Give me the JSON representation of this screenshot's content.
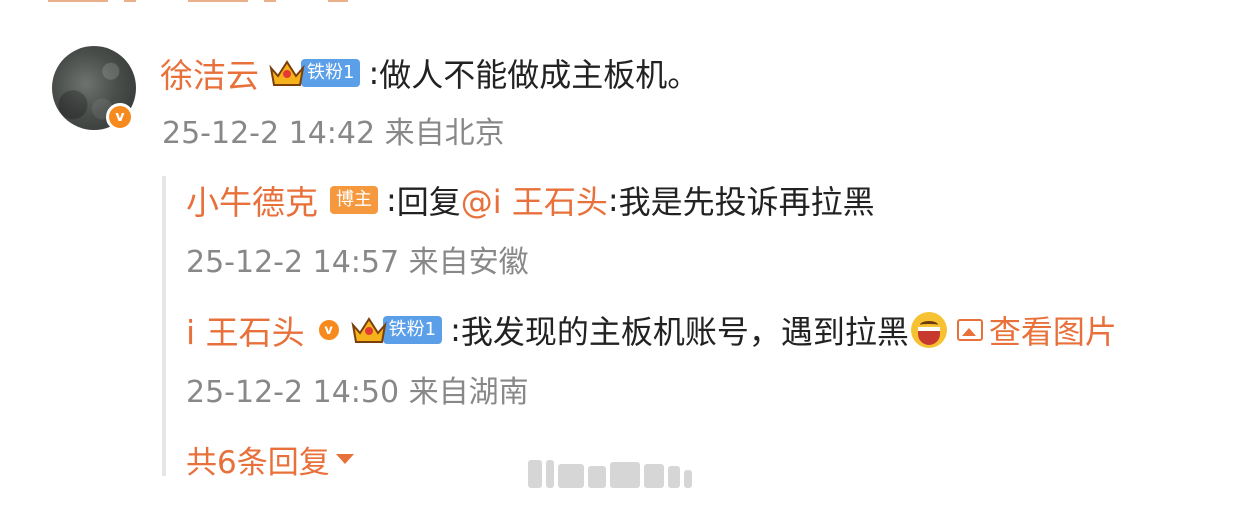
{
  "comment": {
    "author": "徐洁云",
    "fan_badge": "铁粉1",
    "text": "做人不能做成主板机。",
    "time": "25-12-2 14:42",
    "location": "来自北京",
    "verified_icon": "v-badge-icon"
  },
  "replies": [
    {
      "author": "小牛德克",
      "role_badge": "博主",
      "reply_prefix": "回复",
      "mention": "@i 王石头",
      "text": "我是先投诉再拉黑",
      "time": "25-12-2 14:57",
      "location": "来自安徽"
    },
    {
      "author": "i 王石头",
      "fan_badge": "铁粉1",
      "text": "我发现的主板机账号，遇到拉黑",
      "emoji": "grin-emoji",
      "view_image": "查看图片",
      "time": "25-12-2 14:50",
      "location": "来自湖南"
    }
  ],
  "more_replies": "共6条回复",
  "colors": {
    "accent": "#e8703a",
    "fan_badge": "#5b9fe8",
    "blogger_badge": "#f6983e",
    "verified": "#f78a1e"
  }
}
